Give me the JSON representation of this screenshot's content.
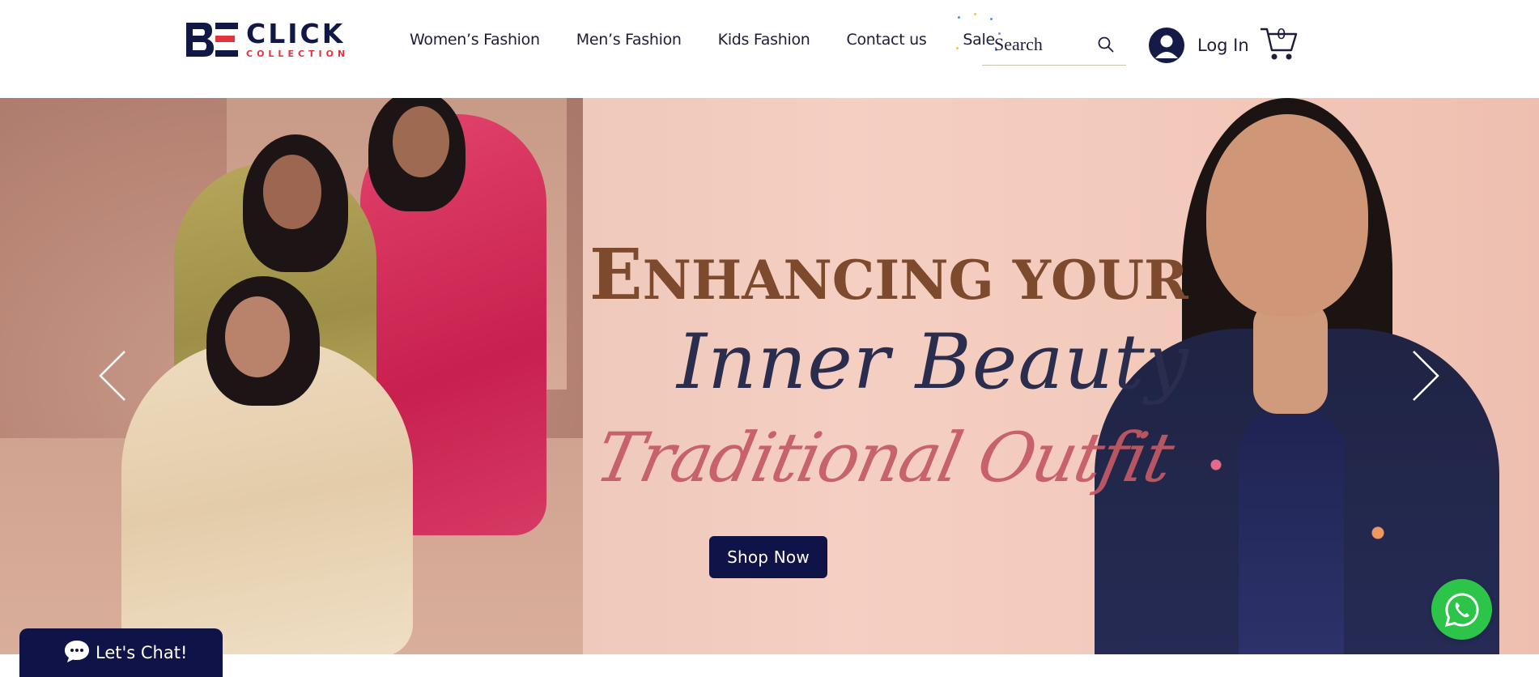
{
  "brand": {
    "logo_word": "CLICK",
    "logo_sub": "COLLECTION",
    "logo_primary_color": "#111845",
    "logo_accent_color": "#e1333d"
  },
  "nav": {
    "items": [
      {
        "label": "Women’s Fashion"
      },
      {
        "label": "Men’s Fashion"
      },
      {
        "label": "Kids Fashion"
      },
      {
        "label": "Contact us"
      },
      {
        "label": "Sale"
      }
    ]
  },
  "search": {
    "placeholder": "Search",
    "icon": "search-icon"
  },
  "account": {
    "login_label": "Log In",
    "icon": "user-avatar-icon"
  },
  "cart": {
    "count": "0",
    "icon": "shopping-cart-icon"
  },
  "hero": {
    "headline_cap": "E",
    "headline_rest": "NHANCING YOUR",
    "headline_line2": "Inner Beauty",
    "headline_line3": "Traditional Outfit",
    "cta_label": "Shop Now",
    "prev_icon": "chevron-left-icon",
    "next_icon": "chevron-right-icon",
    "cta_color": "#101347"
  },
  "chat": {
    "label": "Let's Chat!",
    "icon": "chat-bubble-icon"
  },
  "whatsapp": {
    "icon": "whatsapp-icon",
    "color": "#2cc54a"
  }
}
